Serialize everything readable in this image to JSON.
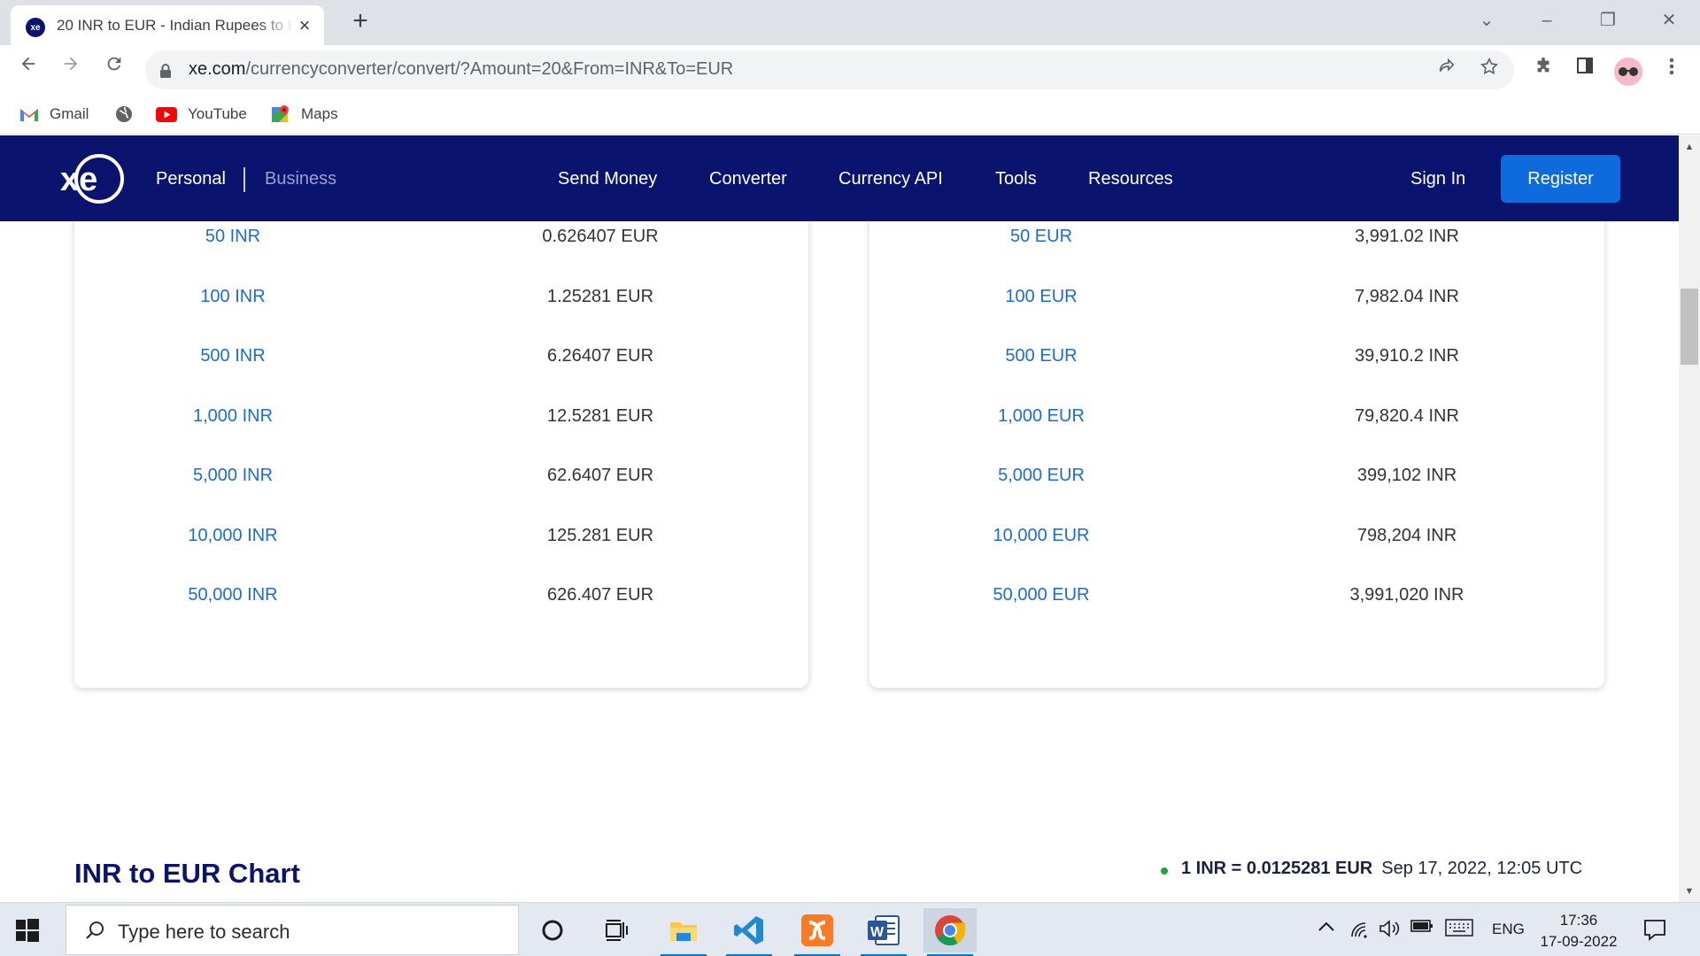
{
  "browser": {
    "tab_title": "20 INR to EUR - Indian Rupees to Euros Exchange Rate",
    "tab_favicon": "xe",
    "url_host": "xe.com",
    "url_path": "/currencyconverter/convert/?Amount=20&From=INR&To=EUR",
    "bookmarks": [
      "Gmail",
      "YouTube",
      "Maps"
    ]
  },
  "xe_nav": {
    "personal": "Personal",
    "business": "Business",
    "links": [
      "Send Money",
      "Converter",
      "Currency API",
      "Tools",
      "Resources"
    ],
    "sign_in": "Sign In",
    "register": "Register"
  },
  "inr_to_eur": [
    {
      "from": "50 INR",
      "to": "0.626407 EUR"
    },
    {
      "from": "100 INR",
      "to": "1.25281 EUR"
    },
    {
      "from": "500 INR",
      "to": "6.26407 EUR"
    },
    {
      "from": "1,000 INR",
      "to": "12.5281 EUR"
    },
    {
      "from": "5,000 INR",
      "to": "62.6407 EUR"
    },
    {
      "from": "10,000 INR",
      "to": "125.281 EUR"
    },
    {
      "from": "50,000 INR",
      "to": "626.407 EUR"
    }
  ],
  "eur_to_inr": [
    {
      "from": "50 EUR",
      "to": "3,991.02 INR"
    },
    {
      "from": "100 EUR",
      "to": "7,982.04 INR"
    },
    {
      "from": "500 EUR",
      "to": "39,910.2 INR"
    },
    {
      "from": "1,000 EUR",
      "to": "79,820.4 INR"
    },
    {
      "from": "5,000 EUR",
      "to": "399,102 INR"
    },
    {
      "from": "10,000 EUR",
      "to": "798,204 INR"
    },
    {
      "from": "50,000 EUR",
      "to": "3,991,020 INR"
    }
  ],
  "chart_section": {
    "title": "INR to EUR Chart",
    "rate": "1 INR = 0.0125281 EUR",
    "rate_date": "Sep 17, 2022, 12:05 UTC"
  },
  "taskbar": {
    "search_placeholder": "Type here to search",
    "language": "ENG",
    "time": "17:36",
    "date": "17-09-2022"
  },
  "colors": {
    "xe_navy": "#0a146e",
    "link_blue": "#1a6dd8",
    "register_blue": "#0d6bdd",
    "live_dot": "#22a33b"
  }
}
